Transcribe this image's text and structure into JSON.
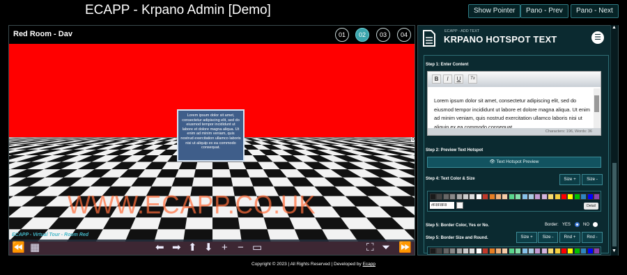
{
  "header": {
    "title": "ECAPP - Krpano Admin [Demo]",
    "show_pointer": "Show Pointer",
    "pano_prev": "Pano - Prev",
    "pano_next": "Pano - Next"
  },
  "viewer": {
    "room": "Red Room - Dav",
    "scenes": [
      "01",
      "02",
      "03",
      "04"
    ],
    "active_scene": "02",
    "hotspot_text": "Lorem ipsum dolor sit amet, consectetur adipiscing elit, sed do eiusmod tempor incididunt ut labore et dolore magna aliqua. Ut enim ad minim veniam, quis nostrud exercitation ullamco laboris nisi ut aliquip ex ea commodo consequat.",
    "watermark": "WWW.ECAPP.CO.UK",
    "tour_caption": "ECAPP - Virtual Tour - Room Red",
    "edge_value": "0"
  },
  "panel": {
    "cms_label": "ECAPP - ADD TEXT",
    "panel_title": "KRPANO HOTSPOT TEXT",
    "step1": "Step 1: Enter Content",
    "toolbar": {
      "bold": "B",
      "italic": "I",
      "underline": "U",
      "clear": "Tx"
    },
    "editor_text": "Lorem ipsum dolor sit amet, consectetur adipiscing elit, sed do eiusmod tempor incididunt ut labore et dolore magna aliqua. Ut enim ad minim veniam, quis nostrud exercitation ullamco laboris nisi ut aliquip ex ea commodo consequat.",
    "counter": "Characters: 196, Words: 36",
    "step2": "Step 2: Preview Text Hotspot",
    "preview_btn": "Text Hotspot Preview",
    "step4": "Step 4: Text Color & Size",
    "size_plus": "Size +",
    "size_minus": "Size -",
    "swatches": [
      "#1a1a1a",
      "#444444",
      "#666666",
      "#888888",
      "#aaaaaa",
      "#cccccc",
      "#dddddd",
      "#ffffff",
      "#c0392b",
      "#e67e22",
      "#f0b27a",
      "#f5cba7",
      "#58d68d",
      "#82e0aa",
      "#85c1e9",
      "#a9cce3",
      "#c39bd3",
      "#d2b4de",
      "#f7dc6f",
      "#f4d03f",
      "#ff0000",
      "#ffff00",
      "#00c000",
      "#2e86c1",
      "#0000ff",
      "#8e44ad"
    ],
    "hex_value": "#F8F8F8",
    "detail_btn": "Detail",
    "step5a": "Step 5: Border Color, Yes or No.",
    "border_label": "Border:",
    "yes": "YES",
    "no": "NO",
    "step5b": "Step 5: Border Size and Round.",
    "rnd_plus": "Rnd +",
    "rnd_minus": "Rnd -"
  },
  "footer": {
    "copyright": "Copyright © 2023 | All Rights Reserved | Developed by",
    "link": "Ecapp"
  }
}
